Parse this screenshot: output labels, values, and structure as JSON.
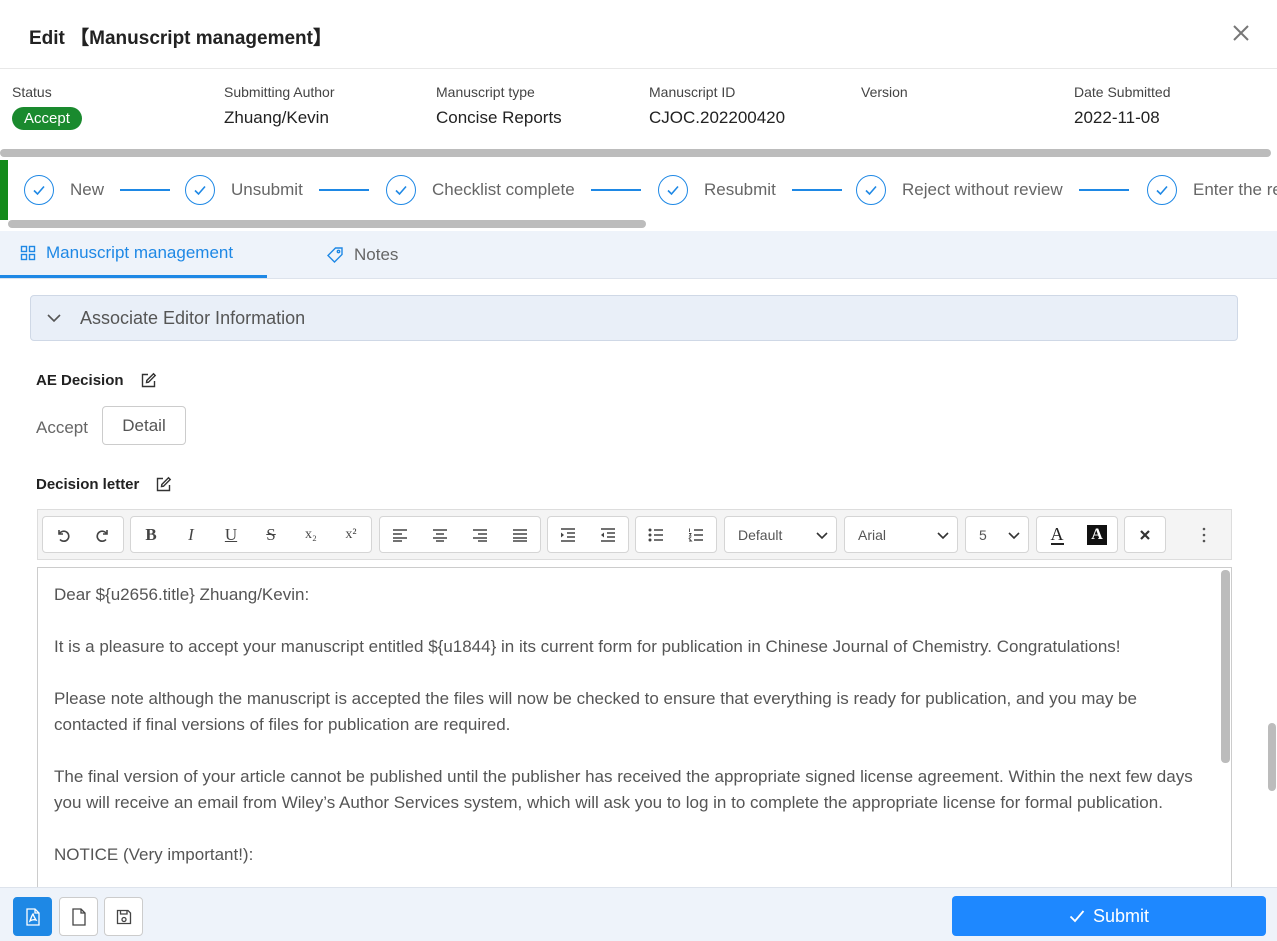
{
  "dialog": {
    "title": "Edit 【Manuscript management】"
  },
  "info": {
    "status_label": "Status",
    "status_value": "Accept",
    "author_label": "Submitting Author",
    "author_value": "Zhuang/Kevin",
    "type_label": "Manuscript type",
    "type_value": "Concise Reports",
    "id_label": "Manuscript ID",
    "id_value": "CJOC.202200420",
    "version_label": "Version",
    "version_value": "",
    "date_label": "Date Submitted",
    "date_value": "2022-11-08"
  },
  "steps": [
    {
      "label": "New"
    },
    {
      "label": "Unsubmit"
    },
    {
      "label": "Checklist complete"
    },
    {
      "label": "Resubmit"
    },
    {
      "label": "Reject without review"
    },
    {
      "label": "Enter the re"
    }
  ],
  "tabs": {
    "manuscript": "Manuscript management",
    "notes": "Notes"
  },
  "panel": {
    "collapse_title": "Associate Editor Information",
    "ae_decision_label": "AE Decision",
    "ae_decision_value": "Accept",
    "detail_button": "Detail",
    "decision_letter_label": "Decision letter"
  },
  "toolbar": {
    "format_select": "Default",
    "font_select": "Arial",
    "size_select": "5",
    "bold": "B",
    "italic": "I",
    "underline": "U",
    "strike": "S",
    "sub": "x₂",
    "sup": "x²",
    "font_color": "A",
    "bg_color": "A"
  },
  "letter": {
    "p1": "Dear ${u2656.title} Zhuang/Kevin:",
    "p2": "It is a pleasure to accept your manuscript entitled ${u1844} in its current form for publication in Chinese Journal of Chemistry. Congratulations!",
    "p3": "Please note although the manuscript is accepted the files will now be checked to ensure that everything is ready for publication, and you may be contacted if final versions of files for publication are required.",
    "p4": "The final version of your article cannot be published until the publisher has received the appropriate signed license agreement. Within the next few days you will receive an email from Wiley’s Author Services system, which will ask you to log in to complete the appropriate license for formal publication.",
    "p5": "NOTICE (Very important!):"
  },
  "footer": {
    "submit_label": "Submit"
  },
  "colors": {
    "accent": "#1e88e5",
    "status_green": "#1a8a2e",
    "tab_bg": "#eef3fa"
  }
}
